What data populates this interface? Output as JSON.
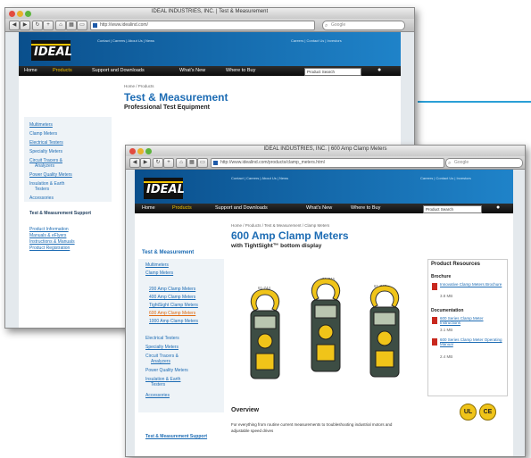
{
  "back_window": {
    "title": "IDEAL INDUSTRIES, INC. | Test & Measurement",
    "url": "http://www.idealind.com/",
    "search_placeholder": "Google",
    "brand": "IDEAL",
    "nav_items": [
      "Home",
      "Products",
      "Support and Downloads",
      "What's New",
      "Where to Buy"
    ],
    "nav_search": "Product Search",
    "breadcrumb": "Home / Products",
    "page_title": "Test & Measurement",
    "page_subtitle": "Professional Test Equipment",
    "sidebar_links": [
      "Multimeters",
      "Clamp Meters",
      "Electrical Testers",
      "Specialty Meters",
      "Circuit Tracers &",
      "Analyzers",
      "Power Quality Meters",
      "Insulation & Earth",
      "Testers",
      "Accessories"
    ],
    "support_title": "Test & Measurement Support",
    "support_links": [
      "Product Information",
      "Manuals & eFlyers",
      "Instructions & Manuals",
      "Product Registration"
    ]
  },
  "front_window": {
    "title": "IDEAL INDUSTRIES, INC. | 600 Amp Clamp Meters",
    "url": "http://www.idealind.com/products/clamp_meters.html",
    "search_placeholder": "Google",
    "brand": "IDEAL",
    "nav_items": [
      "Home",
      "Products",
      "Support and Downloads",
      "What's New",
      "Where to Buy"
    ],
    "nav_search": "Product Search",
    "breadcrumb": "Home / Products / Test & Measurement / Clamp Meters",
    "page_title": "600 Amp Clamp Meters",
    "page_subtitle": "with TightSight™ bottom display",
    "sidebar_title": "Test & Measurement",
    "sidebar_links": [
      "Multimeters",
      "Clamp Meters"
    ],
    "sidebar_sub": [
      "200 Amp Clamp Meters",
      "400 Amp Clamp Meters",
      "TightSight Clamp Meters",
      "600 Amp Clamp Meters",
      "1000 Amp Clamp Meters"
    ],
    "sidebar_links2": [
      "Electrical Testers",
      "Specialty Meters",
      "Circuit Tracers &",
      "Analyzers",
      "Power Quality Meters",
      "Insulation & Earth",
      "Testers",
      "Accessories"
    ],
    "support_title": "Test & Measurement Support",
    "meter_labels": [
      "61-744",
      "61-746",
      "61-747"
    ],
    "resources": {
      "title": "Product Resources",
      "brochure_head": "Brochure",
      "brochure_items": [
        "Innovative Clamp Meters Brochure",
        "3.8 MB"
      ],
      "doc_head": "Documentation",
      "doc_items": [
        "600 Series Clamp Meter Instructions",
        "3.1 MB",
        "600 Series Clamp Meter Operating Manual",
        "2.4 MB"
      ]
    },
    "badges": [
      "UL",
      "CE"
    ],
    "overview_title": "Overview",
    "overview_text": "For everything from routine current measurements to troubleshooting industrial motors and adjustable speed drives"
  },
  "colors": {
    "brand_blue": "#1d6cb4",
    "header_blue": "#0a4f8c",
    "nav_black": "#111111",
    "accent_yellow": "#f2c300",
    "teal_line": "#2a9fd6"
  }
}
